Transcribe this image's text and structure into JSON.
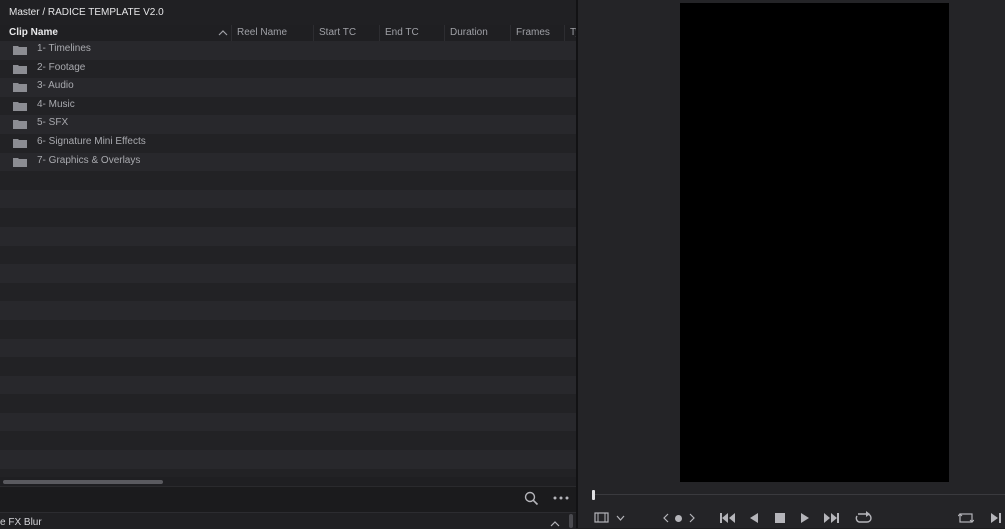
{
  "media_pool": {
    "breadcrumb": "Master / RADICE TEMPLATE V2.0",
    "columns": [
      "Clip Name",
      "Reel Name",
      "Start TC",
      "End TC",
      "Duration",
      "Frames",
      "Ty"
    ],
    "items": [
      {
        "label": "1- Timelines",
        "icon": "folder-icon"
      },
      {
        "label": "2- Footage",
        "icon": "folder-icon"
      },
      {
        "label": "3- Audio",
        "icon": "folder-icon"
      },
      {
        "label": "4- Music",
        "icon": "folder-icon"
      },
      {
        "label": "5- SFX",
        "icon": "folder-icon"
      },
      {
        "label": "6- Signature Mini Effects",
        "icon": "folder-icon"
      },
      {
        "label": "7- Graphics & Overlays",
        "icon": "folder-icon"
      }
    ],
    "footer_icons": [
      "search-icon",
      "more-icon"
    ],
    "bottom_panel_title": "e FX Blur"
  },
  "viewer": {
    "controls": [
      "aspect-icon",
      "chevron-down-icon",
      "jog-left-icon",
      "jog-dot-icon",
      "jog-right-icon",
      "skip-to-start-icon",
      "play-reverse-icon",
      "stop-icon",
      "play-icon",
      "skip-to-end-icon",
      "loop-icon",
      "match-frame-icon",
      "next-frame-icon"
    ]
  },
  "colors": {
    "background": "#1c1c1e",
    "viewer_frame": "#000000",
    "text_primary": "#e6e6e8",
    "text_muted": "#a9aaaf"
  }
}
